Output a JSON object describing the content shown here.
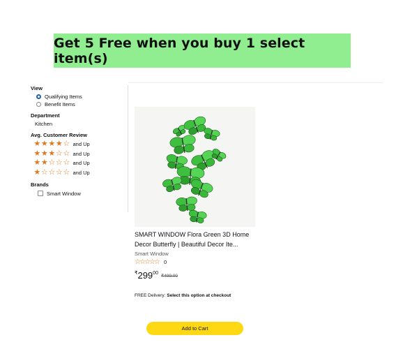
{
  "banner": {
    "text": "Get 5 Free when you buy 1 select item(s)",
    "color": "#90ee90"
  },
  "sidebar": {
    "view": {
      "title": "View",
      "options": [
        {
          "label": "Qualifying Items",
          "selected": true
        },
        {
          "label": "Benefit Items",
          "selected": false
        }
      ]
    },
    "department": {
      "title": "Department",
      "items": [
        "Kitchen"
      ]
    },
    "reviews": {
      "title": "Avg. Customer Review",
      "options": [
        {
          "stars": 4,
          "label": "and Up"
        },
        {
          "stars": 3,
          "label": "and Up"
        },
        {
          "stars": 2,
          "label": "and Up"
        },
        {
          "stars": 1,
          "label": "and Up"
        }
      ]
    },
    "brands": {
      "title": "Brands",
      "items": [
        {
          "label": "Smart Window",
          "checked": false
        }
      ]
    }
  },
  "product": {
    "image_alt": "green butterfly wall decor",
    "title": "SMART WINDOW Flora Green 3D Home Decor Butterfly | Beautiful Decor Ite...",
    "brand": "Smart Window",
    "rating_stars": 0,
    "rating_count": "0",
    "price_symbol": "₹",
    "price_whole": "299",
    "price_fraction": "00",
    "list_price": "₹499.00",
    "delivery_label": "FREE Delivery:",
    "delivery_option": "Select this option at checkout",
    "add_to_cart": "Add to Cart"
  },
  "colors": {
    "star": "#de7921",
    "button": "#ffd814",
    "radio_selected": "#2162a1"
  }
}
